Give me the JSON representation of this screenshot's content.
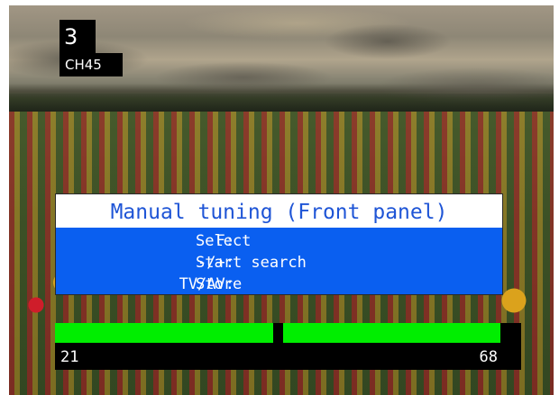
{
  "channel": {
    "number": "3",
    "name": "CH45"
  },
  "menu": {
    "title": "Manual tuning (Front panel)",
    "rows": [
      {
        "key": "F:",
        "value": "Select"
      },
      {
        "key": "-/+:",
        "value": "Start search"
      },
      {
        "key": "TV/AV:",
        "value": "Store"
      }
    ]
  },
  "tuning_bar": {
    "min_label": "21",
    "max_label": "68",
    "position_fraction": 0.5
  },
  "colors": {
    "menu_blue": "#0a5ff0",
    "title_text": "#1f55d6",
    "bar_green": "#00ee00"
  }
}
